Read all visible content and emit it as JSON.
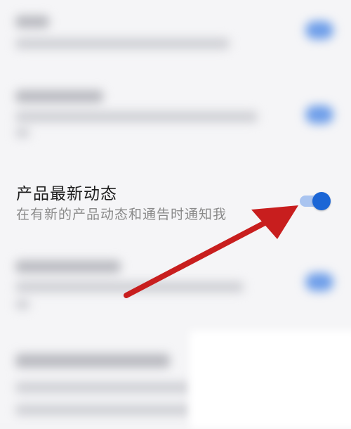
{
  "setting": {
    "title": "产品最新动态",
    "description": "在有新的产品动态和通告时通知我",
    "enabled": true
  },
  "colors": {
    "toggle_on": "#1b66d6",
    "toggle_track": "#a9c4f0",
    "arrow": "#c81e1e"
  }
}
